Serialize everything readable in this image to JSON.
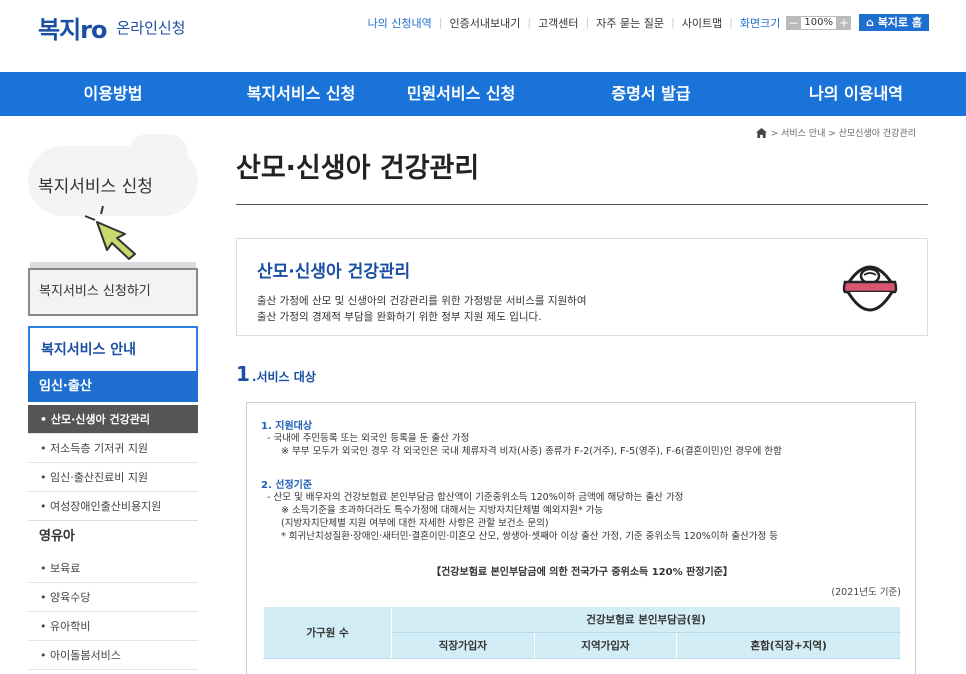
{
  "header": {
    "logo_mark": "복지ro",
    "logo_text": "온라인신청",
    "util_links": [
      "나의 신청내역",
      "인증서내보내기",
      "고객센터",
      "자주 묻는 질문",
      "사이트맵"
    ],
    "zoom_label": "화면크기",
    "zoom_minus": "−",
    "zoom_value": "100%",
    "zoom_plus": "+",
    "home_button": "⌂ 복지로 홈"
  },
  "gnb": [
    "이용방법",
    "복지서비스 신청",
    "민원서비스 신청",
    "증명서 발급",
    "나의 이용내역"
  ],
  "breadcrumb": "> 서비스 안내 > 산모신생아 건강관리",
  "sidebar": {
    "title": "복지서비스 신청",
    "apply": "복지서비스 신청하기",
    "info": "복지서비스 안내",
    "cat1": "임신·출산",
    "cat1_items": [
      "• 산모·신생아 건강관리",
      "• 저소득층 기저귀 지원",
      "• 임신·출산진료비 지원",
      "• 여성장애인출산비용지원"
    ],
    "cat2": "영유아",
    "cat2_items": [
      "• 보육료",
      "• 양육수당",
      "• 유아학비",
      "• 아이돌봄서비스"
    ]
  },
  "main": {
    "title": "산모·신생아 건강관리",
    "intro_title": "산모·신생아 건강관리",
    "intro_line1": "출산 가정에 산모 및 신생아의 건강관리를 위한 가정방문 서비스를 지원하여",
    "intro_line2": "출산 가정의 경제적 부담을 완화하기 위한 정부 지원 제도 입니다.",
    "section_num": "1",
    "section_title": ".서비스 대상",
    "h1": "1. 지원대상",
    "t1a": "- 국내에 주민등록 또는 외국인 등록을 둔 출산 가정",
    "t1b": "※ 부부 모두가 외국인 경우 각 외국인은 국내 체류자격 비자(사증) 종류가 F-2(거주), F-5(영주), F-6(결혼이민)인 경우에 한함",
    "h2": "2. 선정기준",
    "t2a": "- 산모 및 배우자의 건강보험료 본인부담금 합산액이 기준중위소득 120%이하 금액에 해당하는 출산 가정",
    "t2b": "※ 소득기준을 초과하더라도 특수가정에 대해서는 지방자치단체별 예외지원* 가능",
    "t2c": "(지방자치단체별 지원 여부에 대한 자세한 사항은 관할 보건소 문의)",
    "t2d": "* 희귀난치성질환·장애인·새터민·결혼이민·미혼모 산모, 쌍생아·셋째아 이상 출산 가정, 기준 중위소득 120%이하 출산가정 등",
    "criteria_title": "【건강보험료 본인부담금에 의한 전국가구 중위소득 120% 판정기준】",
    "year_note": "(2021년도 기준)",
    "table": {
      "col_household": "가구원 수",
      "col_group": "건강보험료 본인부담금(원)",
      "sub_cols": [
        "직장가입자",
        "지역가입자",
        "혼합(직장+지역)"
      ]
    }
  }
}
